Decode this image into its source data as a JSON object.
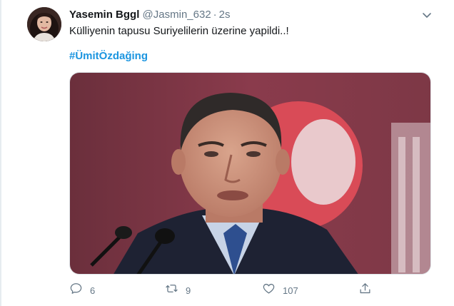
{
  "tweet": {
    "author_name": "Yasemin Bggl",
    "handle": "@Jasmin_632",
    "separator": "·",
    "time": "2s",
    "text": "Külliyenin tapusu Suriyelilerin üzerine yapildi..!",
    "hashtag": "#ÜmitÖzdağing"
  },
  "actions": {
    "reply_count": "6",
    "retweet_count": "9",
    "like_count": "107"
  },
  "icons": {
    "caret": "chevron-down-icon",
    "reply": "reply-icon",
    "retweet": "retweet-icon",
    "like": "heart-icon",
    "share": "share-icon"
  },
  "colors": {
    "link": "#1b95e0",
    "secondary_text": "#657786",
    "icon": "#657786"
  }
}
